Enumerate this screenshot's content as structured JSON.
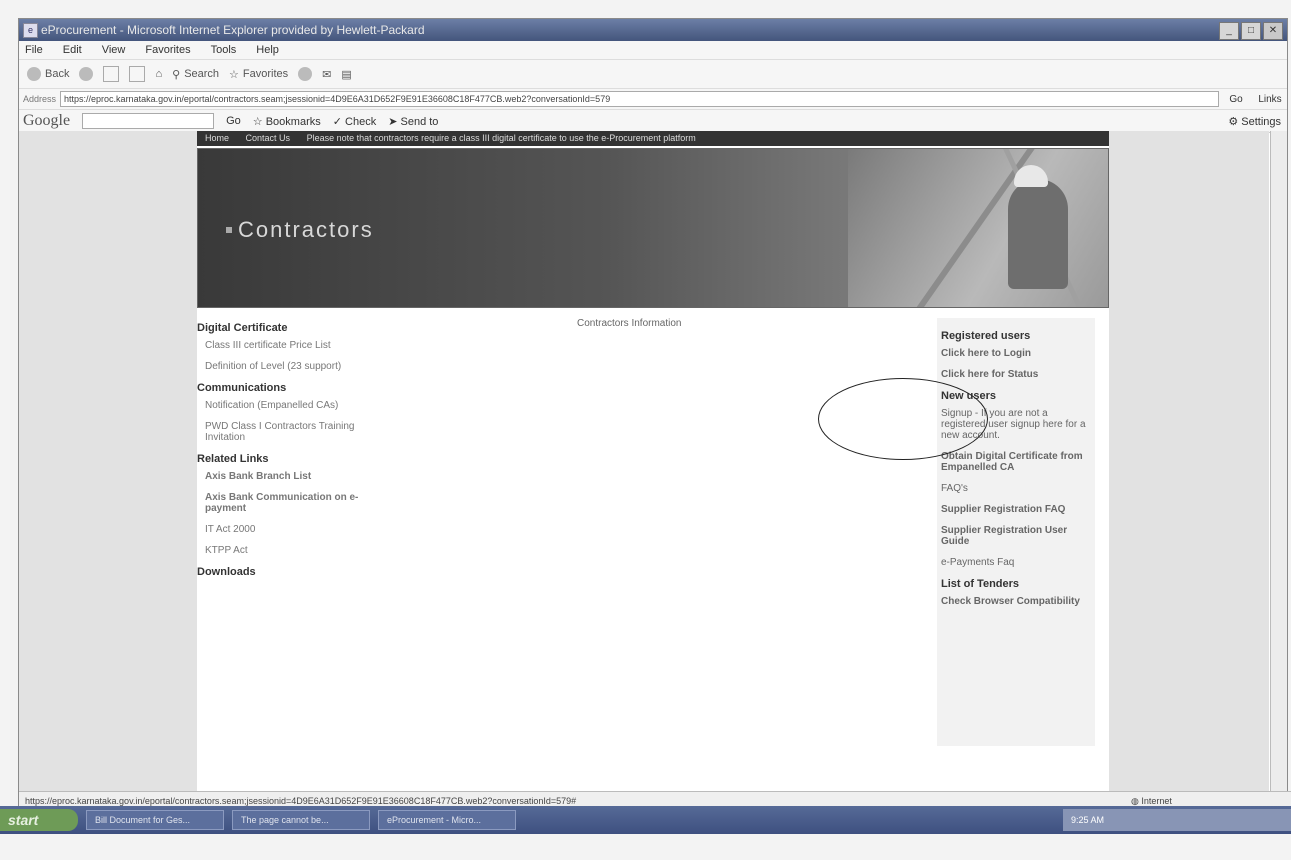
{
  "window": {
    "title": "eProcurement - Microsoft Internet Explorer provided by Hewlett-Packard"
  },
  "menu": [
    "File",
    "Edit",
    "View",
    "Favorites",
    "Tools",
    "Help"
  ],
  "toolbar": {
    "back": "Back",
    "search": "Search",
    "favorites": "Favorites"
  },
  "address": {
    "label": "Address",
    "url": "https://eproc.karnataka.gov.in/eportal/contractors.seam;jsessionid=4D9E6A31D652F9E91E36608C18F477CB.web2?conversationId=579",
    "go": "Go",
    "links": "Links"
  },
  "google": {
    "logo": "Google",
    "go": "Go",
    "bookmarks": "Bookmarks",
    "check": "Check",
    "send_to": "Send to",
    "settings": "Settings"
  },
  "page": {
    "nav_home": "Home",
    "nav_contact": "Contact Us",
    "notice": "Please note that contractors require a class III digital certificate to use the e-Procurement platform",
    "banner_title": "Contractors",
    "center_text": "Contractors Information"
  },
  "left": {
    "digital_cert": "Digital Certificate",
    "link1": "Class III certificate Price List",
    "link2": "Definition of Level (23 support)",
    "communications": "Communications",
    "link3": "Notification (Empanelled CAs)",
    "link4": "PWD Class I Contractors Training Invitation",
    "related": "Related Links",
    "link5": "Axis Bank Branch List",
    "link6": "Axis Bank Communication on e-payment",
    "link7": "IT Act 2000",
    "link8": "KTPP Act",
    "downloads": "Downloads"
  },
  "right": {
    "registered": "Registered users",
    "login": "Click here to Login",
    "status": "Click here for Status",
    "new_users": "New users",
    "signup": "Signup - If you are not a registered user signup here for a new account.",
    "obtain": "Obtain Digital Certificate from Empanelled CA",
    "faqs": "FAQ's",
    "supplier_faq": "Supplier Registration FAQ",
    "supplier_guide": "Supplier Registration User Guide",
    "epayments": "e-Payments Faq",
    "tenders": "List of Tenders",
    "browser": "Check Browser Compatibility"
  },
  "status": {
    "url": "https://eproc.karnataka.gov.in/eportal/contractors.seam;jsessionid=4D9E6A31D652F9E91E36608C18F477CB.web2?conversationId=579#",
    "zone": "Internet"
  },
  "taskbar": {
    "start": "start",
    "task1": "Bill Document for Ges...",
    "task2": "The page cannot be...",
    "task3": "eProcurement - Micro...",
    "clock": "9:25 AM"
  }
}
